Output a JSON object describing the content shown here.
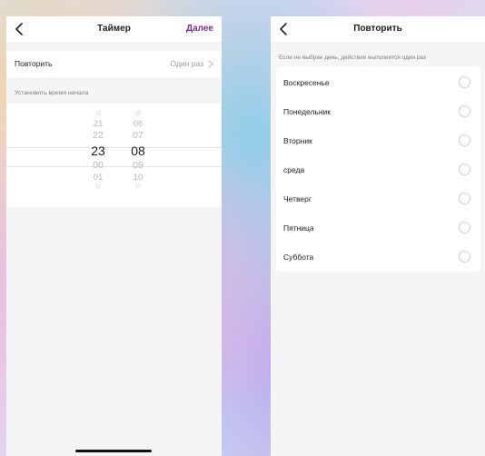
{
  "timer_screen": {
    "title": "Таймер",
    "next_label": "Далее",
    "repeat_row": {
      "label": "Повторить",
      "value": "Один раз"
    },
    "start_time_caption": "Установить время начала",
    "picker": {
      "hours": {
        "far_above": "20",
        "above2": "21",
        "above1": "22",
        "selected": "23",
        "below1": "00",
        "below2": "01",
        "far_below": "02"
      },
      "minutes": {
        "far_above": "05",
        "above2": "06",
        "above1": "07",
        "selected": "08",
        "below1": "09",
        "below2": "10",
        "far_below": "11"
      }
    }
  },
  "repeat_screen": {
    "title": "Повторить",
    "note": "Если не выбран день, действие выполнится один раз",
    "days": [
      "Воскресенье",
      "Понедельник",
      "Вторник",
      "среда",
      "Четверг",
      "Пятница",
      "Суббота"
    ]
  },
  "colors": {
    "accent": "#7a2d8c",
    "background": "#f5f5f7"
  },
  "icons": {
    "back": "chevron-left-icon",
    "row_arrow": "chevron-right-icon"
  }
}
